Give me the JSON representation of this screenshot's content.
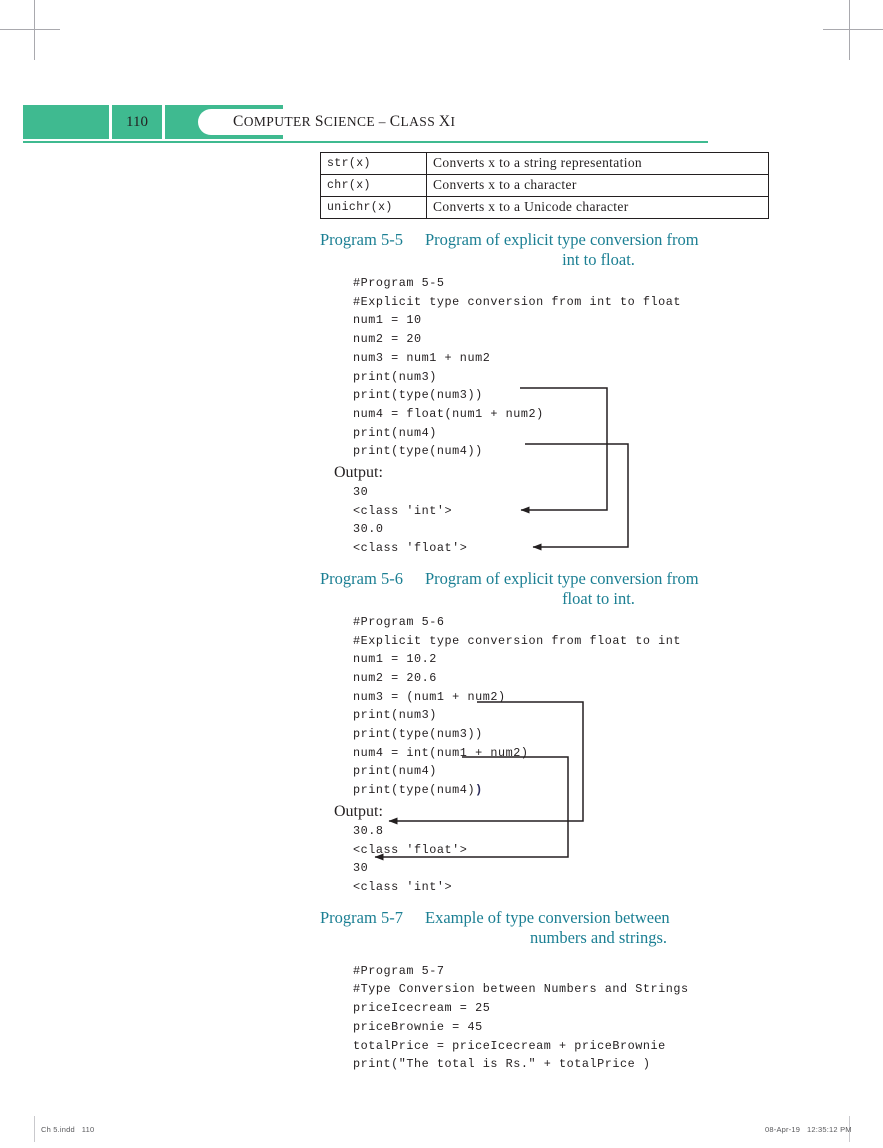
{
  "page": {
    "folio": "110",
    "running_head": "Computer Science – Class XI",
    "accent_green": "#3fba90",
    "heading_teal": "#1b7f93"
  },
  "functions_table": {
    "rows": [
      {
        "function": "str(x)",
        "description": "Converts x to a string representation"
      },
      {
        "function": "chr(x)",
        "description": "Converts x to a character"
      },
      {
        "function": "unichr(x)",
        "description": "Converts x to a Unicode character"
      }
    ]
  },
  "programs": [
    {
      "label": "Program 5-5",
      "title_line1": "Program of explicit type conversion from",
      "title_line2": "int to float.",
      "code": "#Program 5-5\n#Explicit type conversion from int to float\nnum1 = 10\nnum2 = 20\nnum3 = num1 + num2\nprint(num3)\nprint(type(num3))\nnum4 = float(num1 + num2)\nprint(num4)\nprint(type(num4))",
      "output_label": "Output:",
      "output": "30\n<class 'int'>\n30.0\n<class 'float'>"
    },
    {
      "label": "Program 5-6",
      "title_line1": "Program of explicit type conversion from",
      "title_line2": "float to int.",
      "code_pre": "#Program 5-6\n#Explicit type conversion from float to int\nnum1 = 10.2\nnum2 = 20.6\nnum3 = (num1 + num2)\nprint(num3)\nprint(type(num3))\nnum4 = int(num1 + num2)\nprint(num4)\nprint(type(num4)",
      "code_bold_paren": ")",
      "output_label": "Output:",
      "output": "30.8\n<class 'float'>\n30\n<class 'int'>"
    },
    {
      "label": "Program 5-7",
      "title_line1": "Example of type conversion between",
      "title_line2": "numbers and strings.",
      "code": "#Program 5-7\n#Type Conversion between Numbers and Strings\npriceIcecream = 25\npriceBrownie = 45\ntotalPrice = priceIcecream + priceBrownie\nprint(\"The total is Rs.\" + totalPrice )"
    }
  ],
  "footer": {
    "file": "Ch 5.indd   110",
    "timestamp": "08-Apr-19   12:35:12 PM"
  }
}
